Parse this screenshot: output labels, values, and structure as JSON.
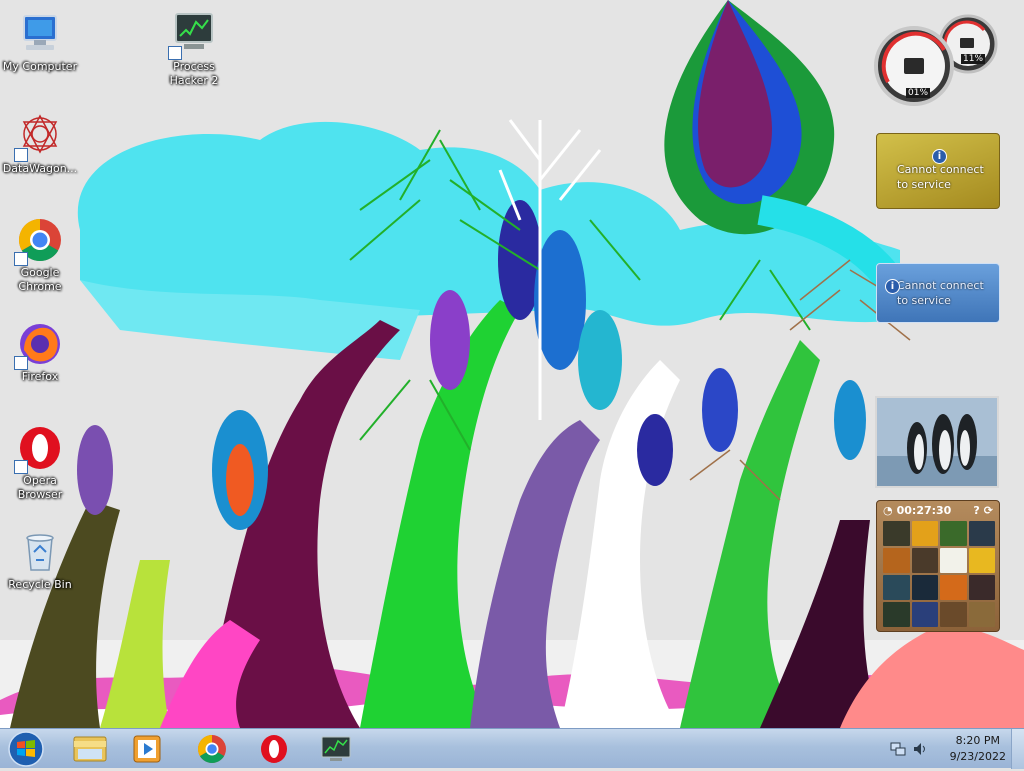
{
  "desktop": {
    "icons": [
      {
        "label": "My Computer",
        "icon": "computer-icon"
      },
      {
        "label": "Process Hacker 2",
        "icon": "process-hacker-icon"
      },
      {
        "label": "DataWagon...",
        "icon": "datawagon-icon"
      },
      {
        "label": "Google Chrome",
        "icon": "chrome-icon"
      },
      {
        "label": "Firefox",
        "icon": "firefox-icon"
      },
      {
        "label": "Opera Browser",
        "icon": "opera-icon"
      },
      {
        "label": "Recycle Bin",
        "icon": "recycle-bin-icon"
      }
    ]
  },
  "gadgets": {
    "cpu_meter": {
      "cpu": "01%",
      "ram": "11%"
    },
    "weather": {
      "message": "Cannot connect to service"
    },
    "feed": {
      "message": "Cannot connect to service"
    },
    "puzzle": {
      "timer": "00:27:30"
    }
  },
  "taskbar": {
    "pinned": [
      "windows-explorer-icon",
      "media-player-icon",
      "chrome-icon",
      "opera-icon",
      "process-hacker-icon"
    ],
    "clock": {
      "time": "8:20 PM",
      "date": "9/23/2022"
    }
  },
  "colors": {
    "taskbar": "#a8c0dd",
    "weather_gadget": "#c7b13a",
    "feed_gadget": "#4f86c8"
  }
}
